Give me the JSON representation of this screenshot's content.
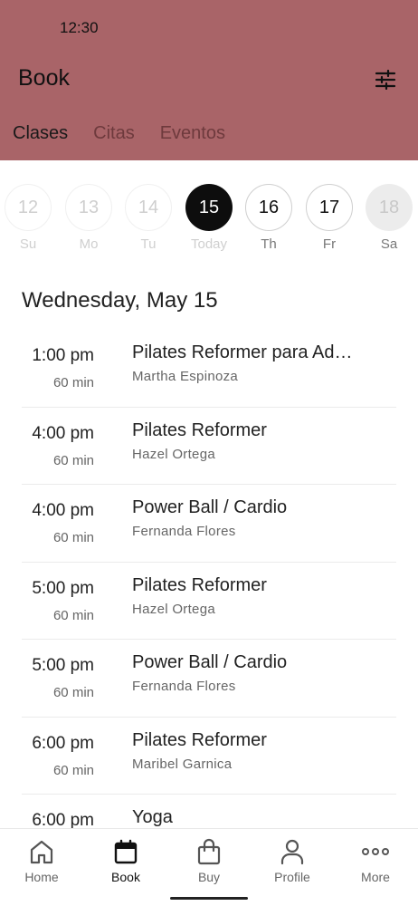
{
  "status_bar": {
    "time": "12:30"
  },
  "header": {
    "title": "Book",
    "filter_icon": "sliders-icon",
    "background": "#a96468"
  },
  "tabs": [
    {
      "label": "Clases",
      "active": true
    },
    {
      "label": "Citas",
      "active": false
    },
    {
      "label": "Eventos",
      "active": false
    }
  ],
  "days": [
    {
      "num": "12",
      "dow": "Su",
      "state": "past"
    },
    {
      "num": "13",
      "dow": "Mo",
      "state": "past"
    },
    {
      "num": "14",
      "dow": "Tu",
      "state": "past"
    },
    {
      "num": "15",
      "dow": "Today",
      "state": "today"
    },
    {
      "num": "16",
      "dow": "Th",
      "state": "future"
    },
    {
      "num": "17",
      "dow": "Fr",
      "state": "future"
    },
    {
      "num": "18",
      "dow": "Sa",
      "state": "disabled"
    }
  ],
  "date_heading": "Wednesday, May 15",
  "classes": [
    {
      "time": "1:00 pm",
      "duration": "60 min",
      "name": "Pilates Reformer para Adultos",
      "instructor": "Martha Espinoza"
    },
    {
      "time": "4:00 pm",
      "duration": "60 min",
      "name": "Pilates Reformer",
      "instructor": "Hazel Ortega"
    },
    {
      "time": "4:00 pm",
      "duration": "60 min",
      "name": "Power Ball / Cardio",
      "instructor": "Fernanda Flores"
    },
    {
      "time": "5:00 pm",
      "duration": "60 min",
      "name": "Pilates Reformer",
      "instructor": "Hazel Ortega"
    },
    {
      "time": "5:00 pm",
      "duration": "60 min",
      "name": "Power Ball / Cardio",
      "instructor": "Fernanda Flores"
    },
    {
      "time": "6:00 pm",
      "duration": "60 min",
      "name": "Pilates Reformer",
      "instructor": "Maribel Garnica"
    },
    {
      "time": "6:00 pm",
      "duration": "",
      "name": "Yoga",
      "instructor": ""
    }
  ],
  "tabbar": [
    {
      "label": "Home",
      "icon": "home-icon",
      "active": false
    },
    {
      "label": "Book",
      "icon": "calendar-icon",
      "active": true
    },
    {
      "label": "Buy",
      "icon": "shopping-bag-icon",
      "active": false
    },
    {
      "label": "Profile",
      "icon": "person-icon",
      "active": false
    },
    {
      "label": "More",
      "icon": "more-dots-icon",
      "active": false
    }
  ]
}
